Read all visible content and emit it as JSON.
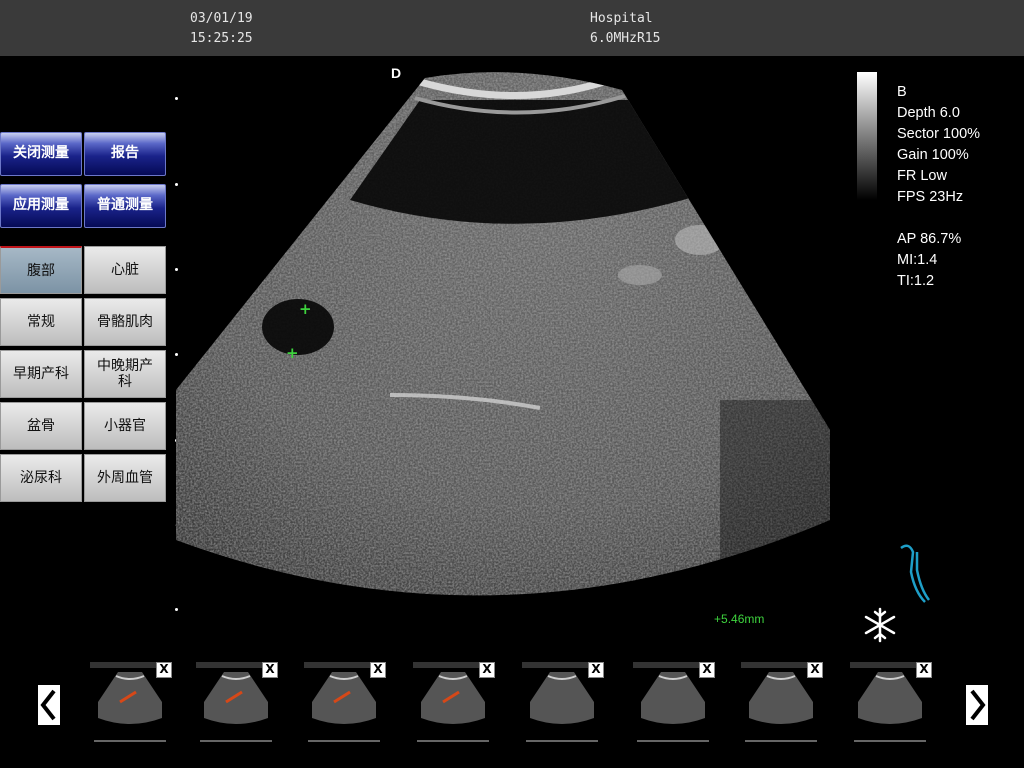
{
  "header": {
    "date": "03/01/19",
    "time": "15:25:25",
    "institution": "Hospital",
    "probe": "6.0MHzR15"
  },
  "left_panel": {
    "measure_buttons": [
      "关闭测量",
      "报告",
      "应用测量",
      "普通测量"
    ],
    "presets": [
      "腹部",
      "心脏",
      "常规",
      "骨骼肌肉",
      "早期产科",
      "中晚期产科",
      "盆骨",
      "小器官",
      "泌尿科",
      "外周血管"
    ],
    "active_preset": "腹部"
  },
  "image": {
    "orientation_marker": "D",
    "measurement": "5.46mm"
  },
  "info_panel": {
    "lines1": [
      "B",
      "Depth 6.0",
      "Sector 100%",
      "Gain 100%",
      "FR Low",
      "FPS 23Hz"
    ],
    "lines2": [
      "AP 86.7%",
      "MI:1.4",
      "TI:1.2"
    ]
  },
  "thumbnails": {
    "count": 8,
    "close_label": "X"
  },
  "icons": {
    "freeze": "snowflake-icon",
    "probe_position": "body-mark-icon",
    "prev": "chevron-left-icon",
    "next": "chevron-right-icon"
  },
  "colors": {
    "measurement": "#3ed33e",
    "bodymark": "#1e9fc8"
  }
}
